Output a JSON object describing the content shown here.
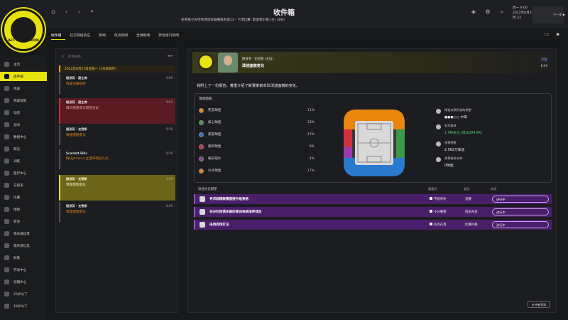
{
  "window": {
    "title": "收件箱",
    "subtitle": "在英格兰天空体育冠军联赛排名第13 - 下场比赛: 斯诺菲尔德 (主) (3天)"
  },
  "logo": {
    "text": "AFC WIMBLEDON"
  },
  "top_right": {
    "day": "周一 9:00",
    "date": "2022年6月27日",
    "week": "周 33",
    "continue_label": "下一步 ▶"
  },
  "sidebar": {
    "items": [
      {
        "label": "主页"
      },
      {
        "label": "收件箱"
      },
      {
        "label": "阵容"
      },
      {
        "label": "阵容规划"
      },
      {
        "label": "动态"
      },
      {
        "label": "战术"
      },
      {
        "label": "数据中心"
      },
      {
        "label": "职员"
      },
      {
        "label": "训练"
      },
      {
        "label": "医疗中心"
      },
      {
        "label": "日程表"
      },
      {
        "label": "比赛"
      },
      {
        "label": "球探"
      },
      {
        "label": "转会"
      },
      {
        "label": "俱乐部远景"
      },
      {
        "label": "俱乐部信息"
      },
      {
        "label": "财政"
      },
      {
        "label": "开发中心"
      },
      {
        "label": "经理中心"
      },
      {
        "label": "23岁以下"
      },
      {
        "label": "18岁以下"
      }
    ]
  },
  "tabs": [
    {
      "label": "收件箱"
    },
    {
      "label": "社交网络反应"
    },
    {
      "label": "新闻"
    },
    {
      "label": "焦点新闻"
    },
    {
      "label": "全球新闻"
    },
    {
      "label": "转会窗口新闻"
    }
  ],
  "search": {
    "placeholder": "所有邮件"
  },
  "list": {
    "date_header": "2022年6月27日星期一 (1条新邮件)",
    "messages": [
      {
        "from": "随身英 · 副主席",
        "subject": "阵容注册规则",
        "time": "9:09"
      },
      {
        "from": "随身英 · 副主席",
        "subject": "俱乐部愿景与期望会议",
        "time": "9:03"
      },
      {
        "from": "随身英 · 史密斯",
        "subject": "球迷面貌变化",
        "time": "8:16"
      },
      {
        "from": "Scarlett Ellis",
        "subject": "确认James入主温布顿战入队",
        "time": "8:16"
      },
      {
        "from": "随身英 · 史密斯",
        "subject": "球迷面貌变化",
        "time": "8:09"
      },
      {
        "from": "随身英 · 史密斯",
        "subject": "球迷面貌变化",
        "time": "8:09"
      }
    ]
  },
  "detail": {
    "from": "随身英 · 史密斯 (主席)",
    "subject": "球迷面貌变化",
    "reply": "回复",
    "time": "8:09",
    "body": "我附上了一份报告，着重介绍了新赛季前本队球迷面貌的变化。",
    "stats_title": "球迷面貌",
    "segments": [
      {
        "name": "死忠球迷",
        "pct": "11%",
        "color": "#e8860e"
      },
      {
        "name": "核心球迷",
        "pct": "33%",
        "color": "#3a9a4a"
      },
      {
        "name": "家族球迷",
        "pct": "27%",
        "color": "#2a7ad0"
      },
      {
        "name": "跟风球迷",
        "pct": "8%",
        "color": "#d03040"
      },
      {
        "name": "娱乐观众",
        "pct": "4%",
        "color": "#9a3ab0"
      },
      {
        "name": "冷淡球迷",
        "pct": "17%",
        "color": "#e8860e"
      }
    ],
    "side_stats": [
      {
        "label": "球迷对俱乐部的期望",
        "value": "●●●○○ 中等"
      },
      {
        "label": "社交媒体",
        "value": "1.9M关注 (增加284.6K)"
      },
      {
        "label": "季票销售",
        "value": "2.062万球迷"
      },
      {
        "label": "季票候补名单",
        "value": "0球迷"
      }
    ],
    "exp_title": "球迷文化期望",
    "exp_cols": {
      "importance": "重要性",
      "category": "类别",
      "status": "状态"
    },
    "expectations": [
      {
        "text": "寻求超越联赛直接升级资格",
        "importance": "不容有失",
        "category": "竞赛",
        "status": "进行中"
      },
      {
        "text": "充分利用俱乐部的青训系统培养球员",
        "importance": "十分重要",
        "category": "球员开发",
        "status": "进行中"
      },
      {
        "text": "采用控球打法",
        "importance": "有点在意",
        "category": "比赛风格",
        "status": "进行中"
      }
    ],
    "support_btn": "支持者资料"
  }
}
